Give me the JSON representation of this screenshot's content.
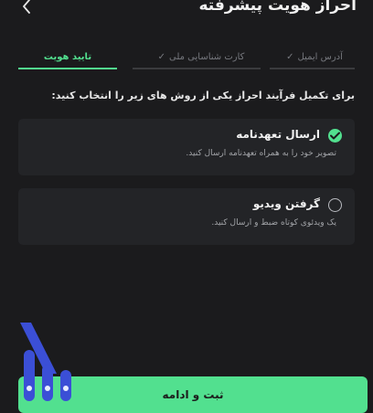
{
  "header": {
    "title": "احراز هویت پیشرفته",
    "back_icon": "chevron-left-icon"
  },
  "steps": [
    {
      "label": "آدرس ایمیل",
      "state": "done"
    },
    {
      "label": "کارت شناسایی ملی",
      "state": "done"
    },
    {
      "label": "تایید هویت",
      "state": "active"
    }
  ],
  "prompt": "برای تکمیل فرآیند احراز یکی از روش های زیر را انتخاب کنید:",
  "options": [
    {
      "title": "ارسال تعهدنامه",
      "description": "تصویر خود را به همراه تعهدنامه ارسال کنید.",
      "selected": true
    },
    {
      "title": "گرفتن ویدیو",
      "description": "یک ویدئوی کوتاه ضبط و ارسال کنید.",
      "selected": false
    }
  ],
  "submit_label": "ثبت و ادامه",
  "colors": {
    "accent": "#52e08f",
    "background": "#1b1b1d",
    "card": "#232427",
    "logo": "#3b4fd6"
  }
}
